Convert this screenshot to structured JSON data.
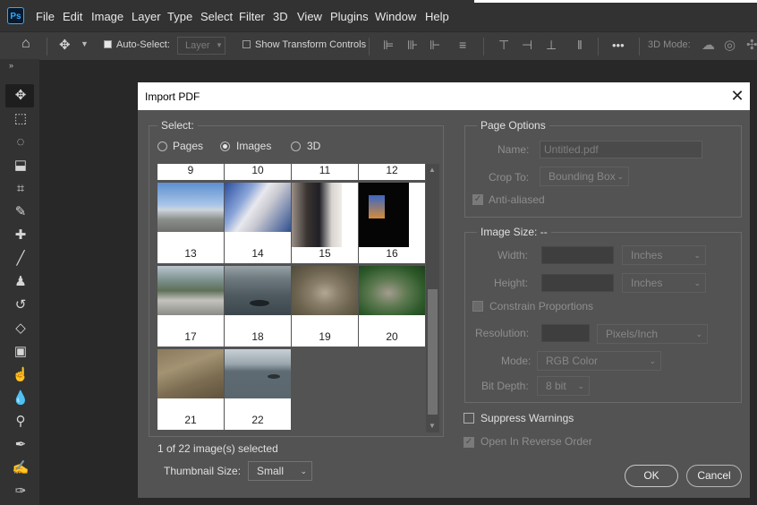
{
  "menubar": {
    "logo": "Ps",
    "items": [
      "File",
      "Edit",
      "Image",
      "Layer",
      "Type",
      "Select",
      "Filter",
      "3D",
      "View",
      "Plugins",
      "Window",
      "Help"
    ]
  },
  "options": {
    "auto_select_label": "Auto-Select:",
    "auto_select_value": "Layer",
    "show_transform_label": "Show Transform Controls",
    "more_label": "•••",
    "mode_3d_label": "3D Mode:"
  },
  "tools": [
    "move-tool-icon",
    "marquee-tool-icon",
    "lasso-tool-icon",
    "object-select-tool-icon",
    "crop-tool-icon",
    "eyedropper-tool-icon",
    "healing-brush-tool-icon",
    "brush-tool-icon",
    "clone-stamp-tool-icon",
    "history-brush-tool-icon",
    "eraser-tool-icon",
    "gradient-tool-icon",
    "smudge-tool-icon",
    "dodge-tool-icon",
    "pen-tool-icon",
    "type-tool-icon",
    "path-select-tool-icon",
    "direct-select-tool-icon"
  ],
  "dialog": {
    "title": "Import PDF",
    "close": "✕",
    "select": {
      "legend": "Select:",
      "options": [
        "Pages",
        "Images",
        "3D"
      ],
      "selected": "Images"
    },
    "thumbnails": {
      "top_row": [
        "9",
        "10",
        "11",
        "12"
      ],
      "items": [
        {
          "num": "13",
          "scene": "sky-building"
        },
        {
          "num": "14",
          "scene": "architecture"
        },
        {
          "num": "15",
          "scene": "airplane-seat"
        },
        {
          "num": "16",
          "scene": "window-dark"
        },
        {
          "num": "17",
          "scene": "pier-person"
        },
        {
          "num": "18",
          "scene": "whale-sea"
        },
        {
          "num": "19",
          "scene": "rabbit-grass"
        },
        {
          "num": "20",
          "scene": "lizard-rock"
        },
        {
          "num": "21",
          "scene": "sand-seal"
        },
        {
          "num": "22",
          "scene": "whale-grey"
        }
      ]
    },
    "status": "1 of 22 image(s) selected",
    "thumbnail_size_label": "Thumbnail Size:",
    "thumbnail_size_value": "Small",
    "page_options": {
      "legend": "Page Options",
      "name_label": "Name:",
      "name_value": "Untitled.pdf",
      "crop_label": "Crop To:",
      "crop_value": "Bounding Box",
      "anti_aliased": "Anti-aliased"
    },
    "image_size": {
      "legend": "Image Size: --",
      "width_label": "Width:",
      "width_unit": "Inches",
      "height_label": "Height:",
      "height_unit": "Inches",
      "constrain": "Constrain Proportions",
      "resolution_label": "Resolution:",
      "resolution_unit": "Pixels/Inch",
      "mode_label": "Mode:",
      "mode_value": "RGB Color",
      "bitdepth_label": "Bit Depth:",
      "bitdepth_value": "8 bit"
    },
    "suppress_warnings": "Suppress Warnings",
    "reverse_order": "Open In Reverse Order",
    "ok": "OK",
    "cancel": "Cancel"
  }
}
